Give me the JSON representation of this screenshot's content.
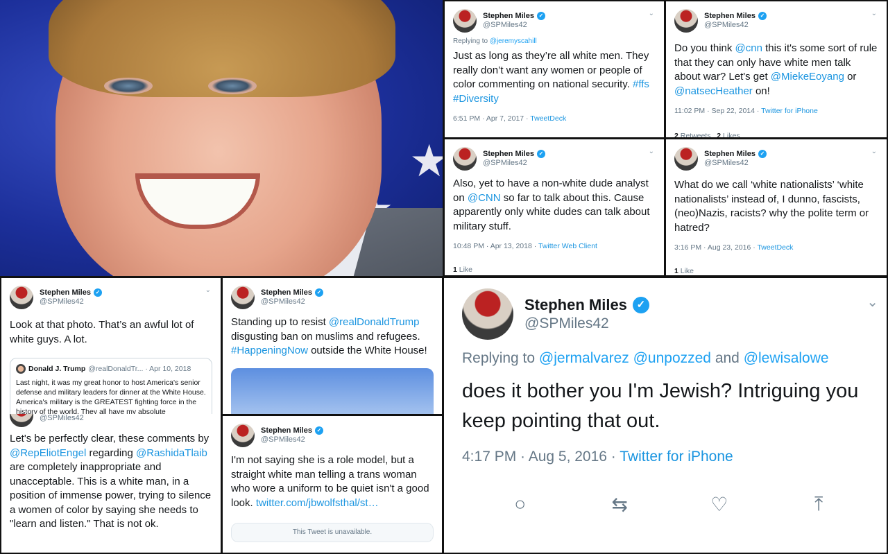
{
  "photo": {
    "description_alt": ""
  },
  "tweets": [
    {
      "name": "Stephen Miles",
      "handle": "@SPMiles42",
      "reply_prefix": "Replying to ",
      "reply_to": "@jeremyscahill",
      "body_1": "Just as long as they’re all white men. They really don’t want any women or people of color commenting on national security. ",
      "tag_1": "#ffs",
      "tag_2": "#Diversity",
      "time": "6:51 PM · Apr 7, 2017 · ",
      "source": "TweetDeck"
    },
    {
      "name": "Stephen Miles",
      "handle": "@SPMiles42",
      "body_1": "Do you think ",
      "mention_1": "@cnn",
      "body_2": " this it's some sort of rule that they can only have white men talk about war? Let's get ",
      "mention_2": "@MiekeEoyang",
      "body_3": " or ",
      "mention_3": "@natsecHeather",
      "body_4": " on!",
      "time": "11:02 PM · Sep 22, 2014 · ",
      "source": "Twitter for iPhone",
      "retweets": "2",
      "retweets_label": " Retweets",
      "likes": "2",
      "likes_label": " Likes"
    },
    {
      "name": "Stephen Miles",
      "handle": "@SPMiles42",
      "body_1": "Also, yet to have a non-white dude analyst on ",
      "mention_1": "@CNN",
      "body_2": " so far to talk about this. Cause apparently only white dudes can talk about military stuff.",
      "time": "10:48 PM · Apr 13, 2018 · ",
      "source": "Twitter Web Client",
      "likes": "1",
      "likes_label": " Like"
    },
    {
      "name": "Stephen Miles",
      "handle": "@SPMiles42",
      "body_1": "What do we call ‘white nationalists’ ‘white nationalists’ instead of, I dunno, fascists, (neo)Nazis, racists? why the polite term or hatred?",
      "time": "3:16 PM · Aug 23, 2016 · ",
      "source": "TweetDeck",
      "likes": "1",
      "likes_label": " Like"
    },
    {
      "name": "Stephen Miles",
      "handle": "@SPMiles42",
      "body_1": "Look at that photo. That’s an awful lot of white guys. A lot.",
      "quote": {
        "name": "Donald J. Trump",
        "handle": "@realDonaldTr... · Apr 10, 2018",
        "body": "Last night, it was my great honor to host America's senior defense and military leaders for dinner at the White House. America's military is the GREATEST fighting force in the history of the world. They all have my absolute commitment to our men and"
      }
    },
    {
      "name": "Stephen Miles",
      "handle": "@SPMiles42",
      "body_1": "Standing up to resist ",
      "mention_1": "@realDonaldTrump",
      "body_2": " disgusting ban on muslims and refugees. ",
      "tag_1": "#HappeningNow",
      "body_3": " outside the White House!"
    },
    {
      "handle": "@SPMiles42",
      "body_1": "Let's be perfectly clear, these comments by ",
      "mention_1": "@RepEliotEngel",
      "body_2": " regarding ",
      "mention_2": "@RashidaTlaib",
      "body_3": " are completely inappropriate and unacceptable. This is a white man, in a position of immense power, trying to silence a women of color by saying she needs to \"learn and listen.\" That is not ok."
    },
    {
      "name": "Stephen Miles",
      "handle": "@SPMiles42",
      "body_1": "I'm not saying she is a role model, but a straight white man telling a trans woman who wore a uniform to be quiet isn't a good look. ",
      "link": "twitter.com/jbwolfsthal/st…",
      "unavailable": "This Tweet is unavailable."
    },
    {
      "name": "Stephen Miles",
      "handle": "@SPMiles42",
      "reply_prefix": "Replying to ",
      "reply_to": "@jermalvarez @unpozzed",
      "reply_and": " and ",
      "reply_to_2": "@lewisalowe",
      "body_1": "does it bother you I'm Jewish? Intriguing you keep pointing that out.",
      "time": "4:17 PM · Aug 5, 2016 · ",
      "source": "Twitter for iPhone"
    }
  ],
  "icons": {
    "reply": "○",
    "retweet": "⇆",
    "like": "♡",
    "share": "⤒",
    "chevron": "⌄",
    "check": "✓"
  }
}
